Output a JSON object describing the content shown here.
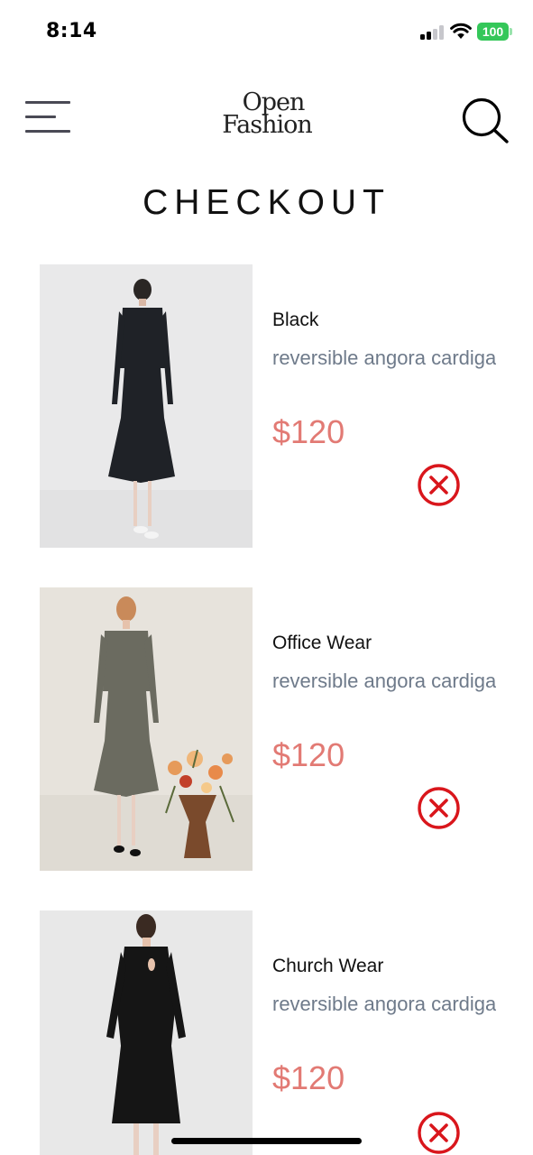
{
  "status_bar": {
    "time": "8:14",
    "battery": "100",
    "icons": [
      "signal-icon",
      "wifi-icon",
      "battery-icon"
    ]
  },
  "header": {
    "menu_icon": "menu-icon",
    "logo_line1": "Open",
    "logo_line2": "Fashion",
    "search_icon": "search-icon"
  },
  "page_title": "CHECKOUT",
  "items": [
    {
      "name": "Black",
      "description": "reversible angora cardigan",
      "price": "$120",
      "image": "black-collared-dress-photo",
      "remove_icon": "remove-circle-x-icon"
    },
    {
      "name": "Office Wear",
      "description": "reversible angora cardigan",
      "price": "$120",
      "image": "grey-office-dress-photo",
      "remove_icon": "remove-circle-x-icon"
    },
    {
      "name": "Church Wear",
      "description": "reversible angora cardigan",
      "price": "$120",
      "image": "black-church-dress-photo",
      "remove_icon": "remove-circle-x-icon"
    }
  ],
  "colors": {
    "price": "#e27a74",
    "description": "#6e7a8a",
    "remove_icon": "#d9161c",
    "battery": "#34c759"
  }
}
